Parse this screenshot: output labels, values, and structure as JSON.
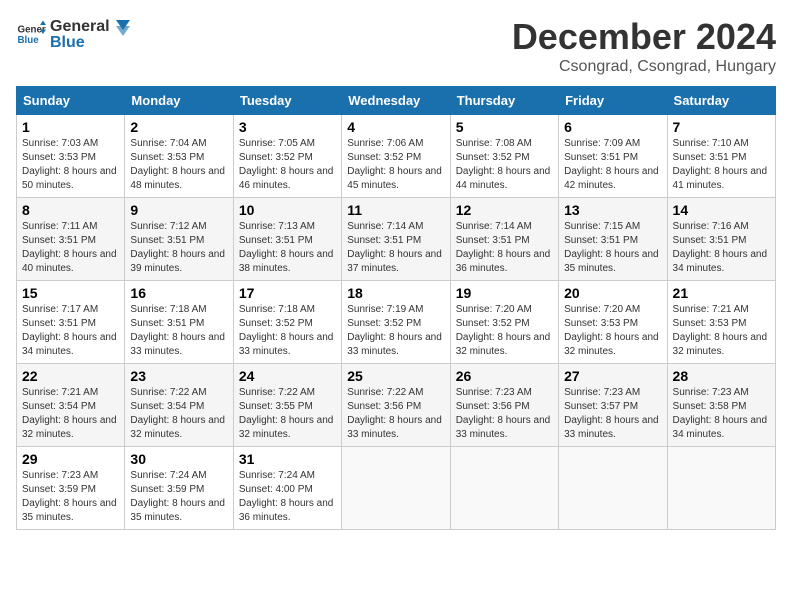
{
  "header": {
    "logo_general": "General",
    "logo_blue": "Blue",
    "month_title": "December 2024",
    "location": "Csongrad, Csongrad, Hungary"
  },
  "weekdays": [
    "Sunday",
    "Monday",
    "Tuesday",
    "Wednesday",
    "Thursday",
    "Friday",
    "Saturday"
  ],
  "weeks": [
    [
      {
        "day": "1",
        "sunrise": "7:03 AM",
        "sunset": "3:53 PM",
        "daylight": "8 hours and 50 minutes."
      },
      {
        "day": "2",
        "sunrise": "7:04 AM",
        "sunset": "3:53 PM",
        "daylight": "8 hours and 48 minutes."
      },
      {
        "day": "3",
        "sunrise": "7:05 AM",
        "sunset": "3:52 PM",
        "daylight": "8 hours and 46 minutes."
      },
      {
        "day": "4",
        "sunrise": "7:06 AM",
        "sunset": "3:52 PM",
        "daylight": "8 hours and 45 minutes."
      },
      {
        "day": "5",
        "sunrise": "7:08 AM",
        "sunset": "3:52 PM",
        "daylight": "8 hours and 44 minutes."
      },
      {
        "day": "6",
        "sunrise": "7:09 AM",
        "sunset": "3:51 PM",
        "daylight": "8 hours and 42 minutes."
      },
      {
        "day": "7",
        "sunrise": "7:10 AM",
        "sunset": "3:51 PM",
        "daylight": "8 hours and 41 minutes."
      }
    ],
    [
      {
        "day": "8",
        "sunrise": "7:11 AM",
        "sunset": "3:51 PM",
        "daylight": "8 hours and 40 minutes."
      },
      {
        "day": "9",
        "sunrise": "7:12 AM",
        "sunset": "3:51 PM",
        "daylight": "8 hours and 39 minutes."
      },
      {
        "day": "10",
        "sunrise": "7:13 AM",
        "sunset": "3:51 PM",
        "daylight": "8 hours and 38 minutes."
      },
      {
        "day": "11",
        "sunrise": "7:14 AM",
        "sunset": "3:51 PM",
        "daylight": "8 hours and 37 minutes."
      },
      {
        "day": "12",
        "sunrise": "7:14 AM",
        "sunset": "3:51 PM",
        "daylight": "8 hours and 36 minutes."
      },
      {
        "day": "13",
        "sunrise": "7:15 AM",
        "sunset": "3:51 PM",
        "daylight": "8 hours and 35 minutes."
      },
      {
        "day": "14",
        "sunrise": "7:16 AM",
        "sunset": "3:51 PM",
        "daylight": "8 hours and 34 minutes."
      }
    ],
    [
      {
        "day": "15",
        "sunrise": "7:17 AM",
        "sunset": "3:51 PM",
        "daylight": "8 hours and 34 minutes."
      },
      {
        "day": "16",
        "sunrise": "7:18 AM",
        "sunset": "3:51 PM",
        "daylight": "8 hours and 33 minutes."
      },
      {
        "day": "17",
        "sunrise": "7:18 AM",
        "sunset": "3:52 PM",
        "daylight": "8 hours and 33 minutes."
      },
      {
        "day": "18",
        "sunrise": "7:19 AM",
        "sunset": "3:52 PM",
        "daylight": "8 hours and 33 minutes."
      },
      {
        "day": "19",
        "sunrise": "7:20 AM",
        "sunset": "3:52 PM",
        "daylight": "8 hours and 32 minutes."
      },
      {
        "day": "20",
        "sunrise": "7:20 AM",
        "sunset": "3:53 PM",
        "daylight": "8 hours and 32 minutes."
      },
      {
        "day": "21",
        "sunrise": "7:21 AM",
        "sunset": "3:53 PM",
        "daylight": "8 hours and 32 minutes."
      }
    ],
    [
      {
        "day": "22",
        "sunrise": "7:21 AM",
        "sunset": "3:54 PM",
        "daylight": "8 hours and 32 minutes."
      },
      {
        "day": "23",
        "sunrise": "7:22 AM",
        "sunset": "3:54 PM",
        "daylight": "8 hours and 32 minutes."
      },
      {
        "day": "24",
        "sunrise": "7:22 AM",
        "sunset": "3:55 PM",
        "daylight": "8 hours and 32 minutes."
      },
      {
        "day": "25",
        "sunrise": "7:22 AM",
        "sunset": "3:56 PM",
        "daylight": "8 hours and 33 minutes."
      },
      {
        "day": "26",
        "sunrise": "7:23 AM",
        "sunset": "3:56 PM",
        "daylight": "8 hours and 33 minutes."
      },
      {
        "day": "27",
        "sunrise": "7:23 AM",
        "sunset": "3:57 PM",
        "daylight": "8 hours and 33 minutes."
      },
      {
        "day": "28",
        "sunrise": "7:23 AM",
        "sunset": "3:58 PM",
        "daylight": "8 hours and 34 minutes."
      }
    ],
    [
      {
        "day": "29",
        "sunrise": "7:23 AM",
        "sunset": "3:59 PM",
        "daylight": "8 hours and 35 minutes."
      },
      {
        "day": "30",
        "sunrise": "7:24 AM",
        "sunset": "3:59 PM",
        "daylight": "8 hours and 35 minutes."
      },
      {
        "day": "31",
        "sunrise": "7:24 AM",
        "sunset": "4:00 PM",
        "daylight": "8 hours and 36 minutes."
      },
      null,
      null,
      null,
      null
    ]
  ]
}
